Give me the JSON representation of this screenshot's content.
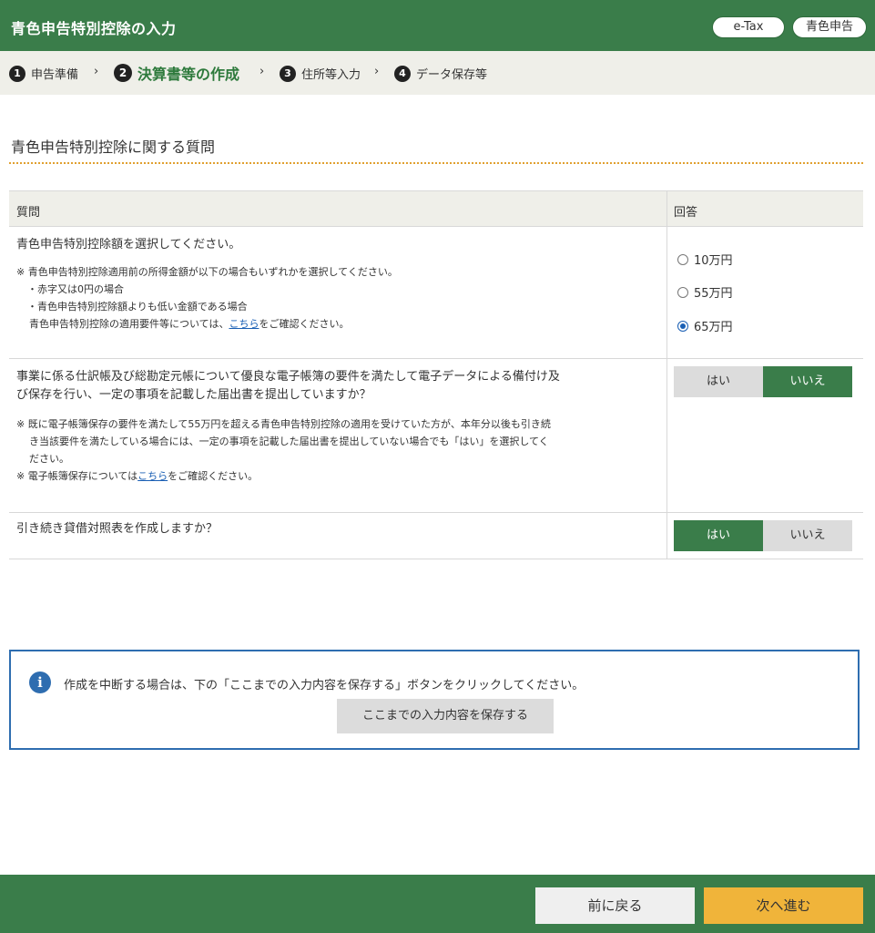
{
  "header": {
    "title": "青色申告特別控除の入力",
    "pill_etax": "e-Tax",
    "pill_type": "青色申告"
  },
  "steps": [
    {
      "num": "1",
      "label": "申告準備"
    },
    {
      "num": "2",
      "label": "決算書等の作成"
    },
    {
      "num": "3",
      "label": "住所等入力"
    },
    {
      "num": "4",
      "label": "データ保存等"
    }
  ],
  "steps_separator": "›",
  "section": {
    "title": "青色申告特別控除に関する質問"
  },
  "table": {
    "col_question": "質問",
    "col_answer": "回答",
    "q1": {
      "text": "青色申告特別控除額を選択してください。",
      "note1": "※ 青色申告特別控除適用前の所得金額が以下の場合もいずれかを選択してください。",
      "note2": "・赤字又は0円の場合",
      "note3": "・青色申告特別控除額よりも低い金額である場合",
      "note4_pre": "青色申告特別控除の適用要件等については、",
      "note4_link": "こちら",
      "note4_post": "をご確認ください。",
      "options": [
        "10万円",
        "55万円",
        "65万円"
      ],
      "selected": "65万円"
    },
    "q2": {
      "line1": "事業に係る仕訳帳及び総勘定元帳について優良な電子帳簿の要件を満たして電子データによる備付け及",
      "line2": "び保存を行い、一定の事項を記載した届出書を提出していますか？",
      "note1": "※ 既に電子帳簿保存の要件を満たして55万円を超える青色申告特別控除の適用を受けていた方が、本年分以後も引き続",
      "note2": "き当該要件を満たしている場合には、一定の事項を記載した届出書を提出していない場合でも「はい」を選択してく",
      "note3": "ださい。",
      "note4_pre": "※ 電子帳簿保存については",
      "note4_link": "こちら",
      "note4_post": "をご確認ください。",
      "yes": "はい",
      "no": "いいえ",
      "selected": "いいえ"
    },
    "q3": {
      "text": "引き続き貸借対照表を作成しますか？",
      "yes": "はい",
      "no": "いいえ",
      "selected": "はい"
    }
  },
  "info": {
    "icon": "i",
    "text": "作成を中断する場合は、下の「ここまでの入力内容を保存する」ボタンをクリックしてください。",
    "save_label": "ここまでの入力内容を保存する"
  },
  "footer": {
    "back_label": "前に戻る",
    "next_label": "次へ進む"
  },
  "colors": {
    "brand_green": "#3a7d4a",
    "accent_orange": "#f0b43a",
    "link_blue": "#1a5fb4",
    "info_blue": "#2e6db0"
  }
}
